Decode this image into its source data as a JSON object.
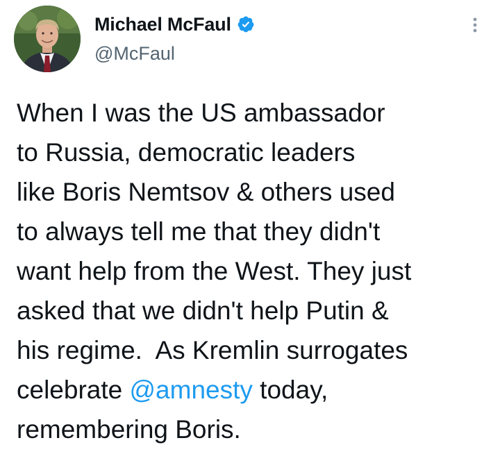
{
  "author": {
    "display_name": "Michael McFaul",
    "handle": "@McFaul",
    "verified": true,
    "avatar_icon": "profile-photo"
  },
  "menu": {
    "icon": "more-options-icon"
  },
  "tweet": {
    "line_1": "When I was the US ambassador",
    "line_2": "to Russia, democratic leaders",
    "line_3": "like Boris Nemtsov & others used",
    "line_4": "to always tell me that they didn't",
    "line_5": "want help from the West. They just",
    "line_6": "asked that we didn't help Putin &",
    "line_7": "his regime.  As Kremlin surrogates",
    "line_8_before": "celebrate ",
    "line_8_mention": "@amnesty",
    "line_8_after": " today,",
    "line_9": "remembering Boris."
  },
  "colors": {
    "text": "#0f1419",
    "secondary": "#536471",
    "accent": "#1d9bf0"
  }
}
